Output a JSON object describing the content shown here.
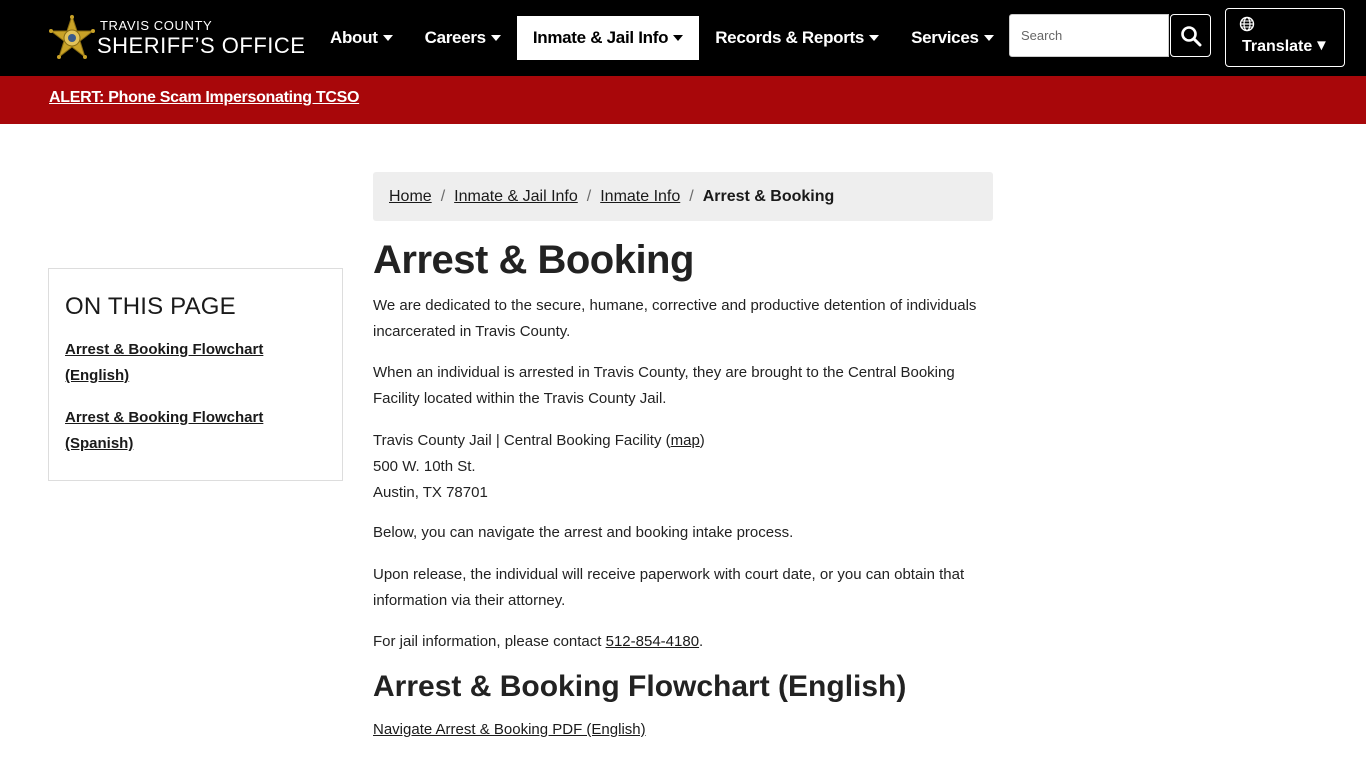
{
  "header": {
    "logo_top": "TRAVIS COUNTY",
    "logo_main": "SHERIFF’S OFFICE",
    "nav": [
      {
        "label": "About"
      },
      {
        "label": "Careers"
      },
      {
        "label": "Inmate & Jail Info"
      },
      {
        "label": "Records & Reports"
      },
      {
        "label": "Services"
      }
    ],
    "search_placeholder": "Search",
    "translate_label": "Translate",
    "translate_arrow": "▼"
  },
  "alert": {
    "text": "ALERT: Phone Scam Impersonating TCSO"
  },
  "sidebar": {
    "title": "ON THIS PAGE",
    "links": [
      {
        "label": "Arrest & Booking Flowchart (English)"
      },
      {
        "label": "Arrest & Booking Flowchart (Spanish)"
      }
    ]
  },
  "breadcrumb": {
    "items": [
      {
        "label": "Home"
      },
      {
        "label": "Inmate & Jail Info"
      },
      {
        "label": "Inmate Info"
      }
    ],
    "current": "Arrest & Booking",
    "separator": "/"
  },
  "main": {
    "title": "Arrest & Booking",
    "p1": "We are dedicated to the secure, humane, corrective and productive detention of individuals incarcerated in Travis County.",
    "p2": "When an individual is arrested in Travis County, they are brought to the Central Booking Facility located within the Travis County Jail.",
    "address_name": "Travis County Jail | Central Booking Facility (",
    "address_map_link": "map",
    "address_close": ")",
    "address_street": "500 W. 10th St.",
    "address_city": "Austin, TX 78701",
    "p4": "Below, you can navigate the arrest and booking intake process.",
    "p5": "Upon release, the individual will receive paperwork with court date, or you can obtain that information via their attorney.",
    "p6_prefix": "For jail information, please contact ",
    "p6_phone": "512-854-4180",
    "p6_suffix": ".",
    "section_title": "Arrest & Booking Flowchart (English)",
    "pdf_link": "Navigate Arrest & Booking PDF (English)"
  },
  "colors": {
    "header_bg": "#000000",
    "alert_bg": "#a8070a",
    "badge_gold": "#c9a227"
  },
  "icons": {
    "logo": "sheriff-star-icon",
    "search": "search-icon",
    "translate": "globe-icon",
    "caret": "chevron-down-icon"
  }
}
